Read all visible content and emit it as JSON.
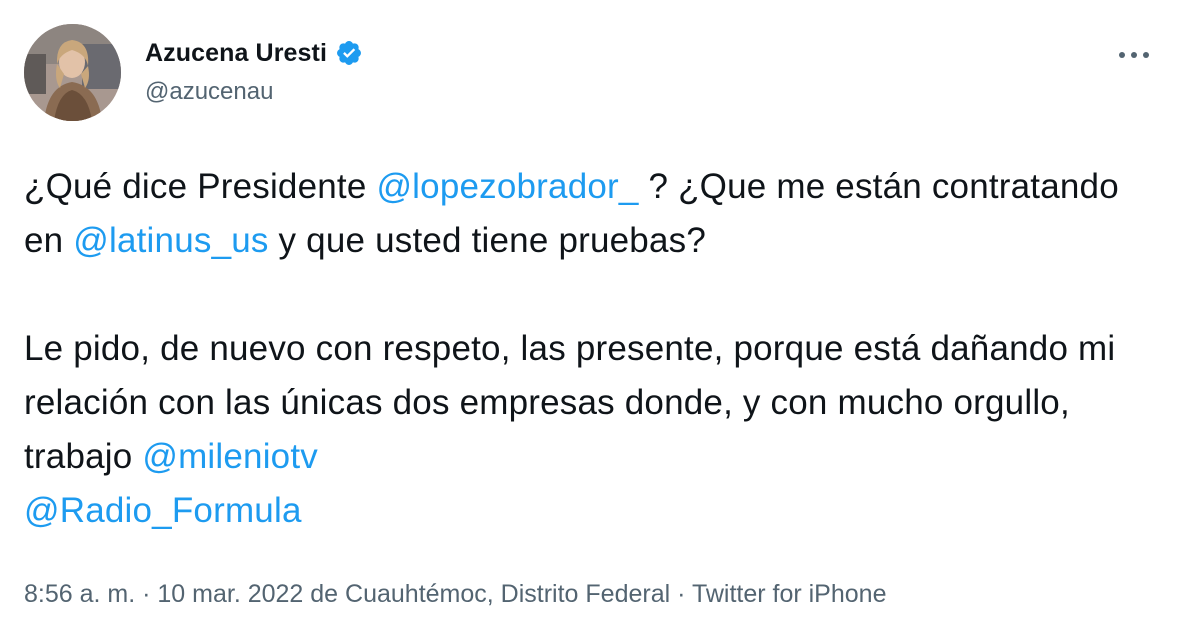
{
  "author": {
    "display_name": "Azucena Uresti",
    "handle": "@azucenau",
    "verified": true
  },
  "tweet": {
    "line1": {
      "t1": "¿Qué dice Presidente ",
      "m1": "@lopezobrador_",
      "t2": " ? ¿Que me están contratando en ",
      "m2": "@latinus_us",
      "t3": " y que usted tiene pruebas?"
    },
    "line2": {
      "t1": "Le pido, de nuevo con respeto, las presente, porque está dañando mi relación con las únicas dos empresas donde, y con mucho orgullo, trabajo ",
      "m1": "@mileniotv",
      "m2": "@Radio_Formula"
    }
  },
  "meta": {
    "time": "8:56 a. m.",
    "sep1": " · ",
    "date": "10 mar. 2022",
    "location": " de Cuauhtémoc, Distrito Federal",
    "sep2": " · ",
    "source": "Twitter for iPhone"
  },
  "icons": {
    "more": "more-horizontal-icon",
    "verified": "verified-badge-icon"
  },
  "colors": {
    "mention": "#1d9bf0",
    "text": "#0f1419",
    "muted": "#536471"
  }
}
